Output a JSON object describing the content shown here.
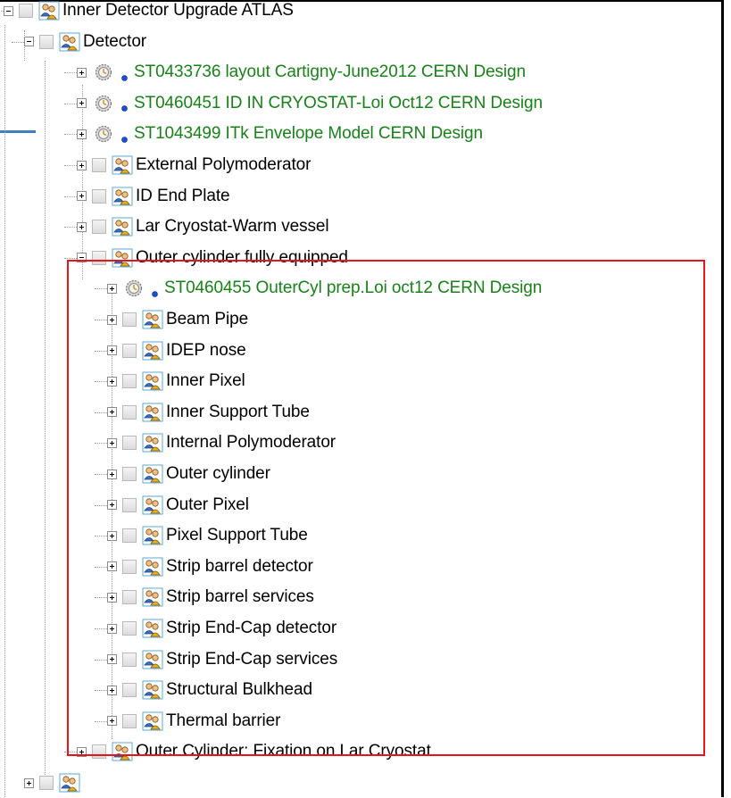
{
  "tree": {
    "root": {
      "label": "Inner Detector Upgrade ATLAS"
    },
    "detector": {
      "label": "Detector"
    },
    "detector_children": [
      {
        "label": "ST0433736 layout Cartigny-June2012  CERN Design",
        "kind": "config"
      },
      {
        "label": "ST0460451 ID IN CRYOSTAT-Loi Oct12  CERN Design",
        "kind": "config"
      },
      {
        "label": "ST1043499 ITk Envelope Model  CERN Design",
        "kind": "config"
      },
      {
        "label": "External Polymoderator",
        "kind": "group"
      },
      {
        "label": "ID End Plate",
        "kind": "group"
      },
      {
        "label": "Lar Cryostat-Warm vessel",
        "kind": "group"
      },
      {
        "label": "Outer cylinder fully equipped",
        "kind": "group",
        "expanded": true
      }
    ],
    "outer_cylinder_children": [
      {
        "label": "ST0460455 OuterCyl prep.Loi oct12  CERN Design",
        "kind": "config"
      },
      {
        "label": "Beam Pipe",
        "kind": "group"
      },
      {
        "label": "IDEP nose",
        "kind": "group"
      },
      {
        "label": "Inner Pixel",
        "kind": "group"
      },
      {
        "label": "Inner Support Tube",
        "kind": "group"
      },
      {
        "label": "Internal Polymoderator",
        "kind": "group"
      },
      {
        "label": "Outer cylinder",
        "kind": "group"
      },
      {
        "label": "Outer Pixel",
        "kind": "group"
      },
      {
        "label": "Pixel Support Tube",
        "kind": "group"
      },
      {
        "label": "Strip barrel detector",
        "kind": "group"
      },
      {
        "label": "Strip barrel services",
        "kind": "group"
      },
      {
        "label": "Strip End-Cap detector",
        "kind": "group"
      },
      {
        "label": "Strip End-Cap services",
        "kind": "group"
      },
      {
        "label": "Structural Bulkhead",
        "kind": "group"
      },
      {
        "label": "Thermal barrier",
        "kind": "group"
      }
    ],
    "after": {
      "label": "Outer Cylinder: Fixation on Lar Cryostat"
    }
  },
  "colors": {
    "config_text": "#178317",
    "highlight_border": "#e8141c",
    "accent": "#3e7fbf"
  },
  "icons": {
    "group": "user-group-icon",
    "config": "gear-clock-icon",
    "bullet": "blue-dot-icon"
  }
}
